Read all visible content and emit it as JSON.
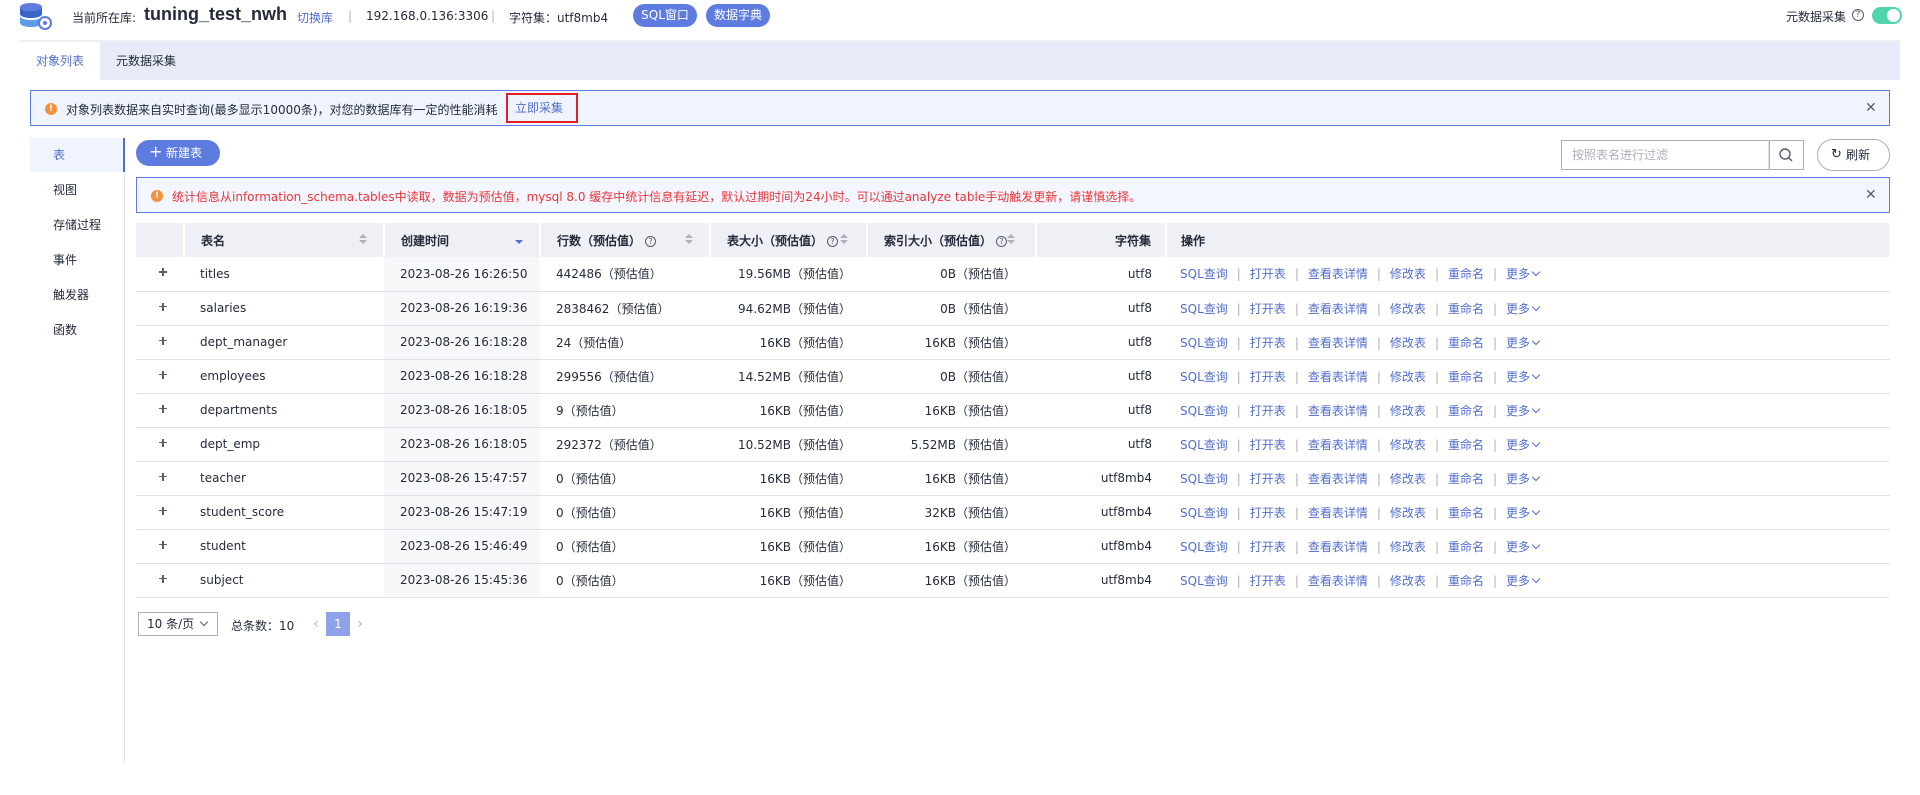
{
  "header": {
    "current_db_label": "当前所在库:",
    "db_name": "tuning_test_nwh",
    "switch_db": "切换库",
    "host": "192.168.0.136:3306",
    "charset": "字符集：utf8mb4",
    "sql_window": "SQL窗口",
    "data_dict": "数据字典",
    "meta_collect": "元数据采集",
    "meta_collect_enabled": true
  },
  "tabs": [
    {
      "label": "对象列表",
      "active": true
    },
    {
      "label": "元数据采集",
      "active": false
    }
  ],
  "info_banner": {
    "text": "对象列表数据来自实时查询(最多显示10000条)，对您的数据库有一定的性能消耗",
    "link": "立即采集"
  },
  "nav": [
    {
      "label": "表",
      "active": true
    },
    {
      "label": "视图"
    },
    {
      "label": "存储过程"
    },
    {
      "label": "事件"
    },
    {
      "label": "触发器"
    },
    {
      "label": "函数"
    }
  ],
  "toolbar": {
    "new_table": "新建表",
    "search_placeholder": "按照表名进行过滤",
    "refresh": "刷新"
  },
  "warning": {
    "text": "统计信息从information_schema.tables中读取，数据为预估值，mysql 8.0 缓存中统计信息有延迟，默认过期时间为24小时。可以通过analyze table手动触发更新，请谨慎选择。"
  },
  "table": {
    "columns": [
      "表名",
      "创建时间",
      "行数（预估值）",
      "表大小（预估值）",
      "索引大小（预估值）",
      "字符集",
      "操作"
    ],
    "actions": [
      "SQL查询",
      "打开表",
      "查看表详情",
      "修改表",
      "重命名",
      "更多"
    ],
    "rows": [
      {
        "name": "titles",
        "created": "2023-08-26 16:26:50",
        "rows": "442486（预估值）",
        "size": "19.56MB（预估值）",
        "index": "0B（预估值）",
        "charset": "utf8"
      },
      {
        "name": "salaries",
        "created": "2023-08-26 16:19:36",
        "rows": "2838462（预估值）",
        "size": "94.62MB（预估值）",
        "index": "0B（预估值）",
        "charset": "utf8"
      },
      {
        "name": "dept_manager",
        "created": "2023-08-26 16:18:28",
        "rows": "24（预估值）",
        "size": "16KB（预估值）",
        "index": "16KB（预估值）",
        "charset": "utf8"
      },
      {
        "name": "employees",
        "created": "2023-08-26 16:18:28",
        "rows": "299556（预估值）",
        "size": "14.52MB（预估值）",
        "index": "0B（预估值）",
        "charset": "utf8"
      },
      {
        "name": "departments",
        "created": "2023-08-26 16:18:05",
        "rows": "9（预估值）",
        "size": "16KB（预估值）",
        "index": "16KB（预估值）",
        "charset": "utf8"
      },
      {
        "name": "dept_emp",
        "created": "2023-08-26 16:18:05",
        "rows": "292372（预估值）",
        "size": "10.52MB（预估值）",
        "index": "5.52MB（预估值）",
        "charset": "utf8"
      },
      {
        "name": "teacher",
        "created": "2023-08-26 15:47:57",
        "rows": "0（预估值）",
        "size": "16KB（预估值）",
        "index": "16KB（预估值）",
        "charset": "utf8mb4"
      },
      {
        "name": "student_score",
        "created": "2023-08-26 15:47:19",
        "rows": "0（预估值）",
        "size": "16KB（预估值）",
        "index": "32KB（预估值）",
        "charset": "utf8mb4"
      },
      {
        "name": "student",
        "created": "2023-08-26 15:46:49",
        "rows": "0（预估值）",
        "size": "16KB（预估值）",
        "index": "16KB（预估值）",
        "charset": "utf8mb4"
      },
      {
        "name": "subject",
        "created": "2023-08-26 15:45:36",
        "rows": "0（预估值）",
        "size": "16KB（预估值）",
        "index": "16KB（预估值）",
        "charset": "utf8mb4"
      }
    ]
  },
  "pagination": {
    "page_size": "10 条/页",
    "total": "总条数：10",
    "current_page": "1"
  },
  "colors": {
    "accent": "#5e7ce0",
    "link": "#526ecc",
    "warning_text": "#e6373a",
    "toggle_on": "#50d4ab"
  }
}
